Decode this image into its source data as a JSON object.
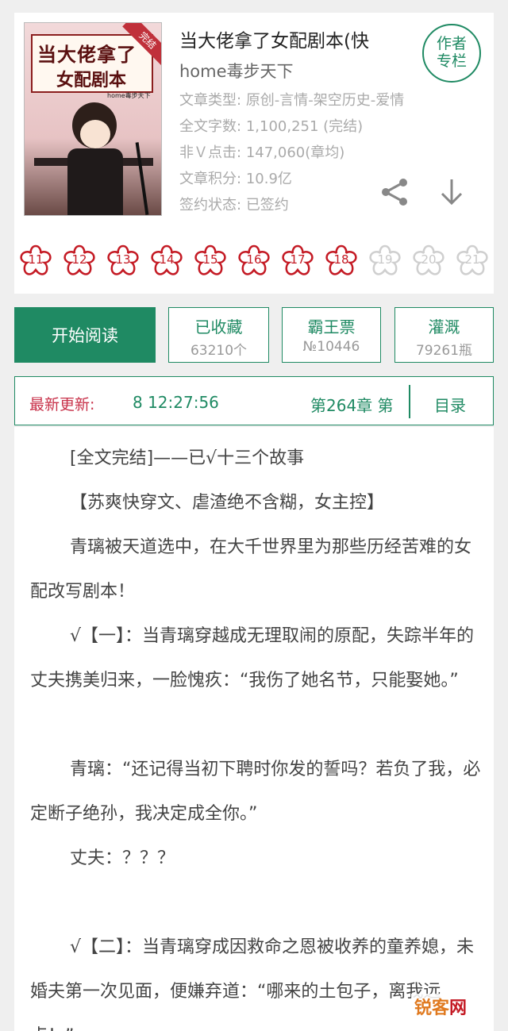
{
  "book": {
    "title": "当大佬拿了女配剧本(快",
    "author": "home毒步天下",
    "cover": {
      "title_line1": "当大佬拿了",
      "title_line2": "女配剧本",
      "badge": "完结",
      "author_small": "home毒步天下"
    },
    "meta": [
      {
        "key": "文章类型:",
        "value": "原创-言情-架空历史-爱情"
      },
      {
        "key": "全文字数:",
        "value": "1,100,251 (完结)"
      },
      {
        "key": "非Ｖ点击:",
        "value": "147,060(章均)"
      },
      {
        "key": "文章积分:",
        "value": "10.9亿"
      },
      {
        "key": "签约状态:",
        "value": "已签约"
      }
    ],
    "author_column": {
      "line1": "作者",
      "line2": "专栏"
    }
  },
  "icons": {
    "share": "share-icon",
    "download": "download-icon",
    "flower": "flower-icon"
  },
  "flowers": [
    {
      "num": "11",
      "active": true
    },
    {
      "num": "12",
      "active": true
    },
    {
      "num": "13",
      "active": true
    },
    {
      "num": "14",
      "active": true
    },
    {
      "num": "15",
      "active": true
    },
    {
      "num": "16",
      "active": true
    },
    {
      "num": "17",
      "active": true
    },
    {
      "num": "18",
      "active": true
    },
    {
      "num": "19",
      "active": false
    },
    {
      "num": "20",
      "active": false
    },
    {
      "num": "21",
      "active": false
    }
  ],
  "actions": {
    "read": "开始阅读",
    "collect": {
      "label": "已收藏",
      "value": "63210个"
    },
    "ticket": {
      "label": "霸王票",
      "value": "№10446"
    },
    "water": {
      "label": "灌溉",
      "value": "79261瓶"
    }
  },
  "update": {
    "label": "最新更新:",
    "time": "8 12:27:56",
    "chapter": "第264章  第",
    "toc": "目录"
  },
  "content": {
    "paragraphs": [
      "[全文完结]——已√十三个故事",
      "【苏爽快穿文、虐渣绝不含糊，女主控】",
      "青璃被天道选中，在大千世界里为那些历经苦难的女配改写剧本！",
      "√【一】：当青璃穿越成无理取闹的原配，失踪半年的丈夫携美归来，一脸愧疚：“我伤了她名节，只能娶她。”",
      "青璃：“还记得当初下聘时你发的誓吗？若负了我，必定断子绝孙，我决定成全你。”",
      "丈夫：？？？",
      "√【二】：当青璃穿成因救命之恩被收养的童养媳，未婚夫第一次见面，便嫌弃道：“哪来的土包子，离我远点！”"
    ]
  },
  "watermark": {
    "part1": "锐客",
    "part2": "网"
  },
  "colors": {
    "accent": "#1f8a63",
    "flower_active": "#c41a24",
    "flower_inactive": "#c8c8c8",
    "update_label": "#c8324a"
  }
}
